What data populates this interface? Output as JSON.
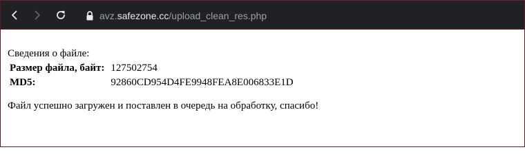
{
  "browser": {
    "url": {
      "prefix": "avz.",
      "domain": "safezone.cc",
      "path": "/upload_clean_res.php"
    },
    "colors": {
      "toolbar_bg": "#202124",
      "frame_accent": "#6b1f2c"
    },
    "icons": {
      "back": "back-arrow-icon",
      "forward": "forward-arrow-icon",
      "reload": "reload-icon",
      "secure": "lock-icon"
    }
  },
  "page": {
    "section_title": "Сведения о файле:",
    "file_info": [
      {
        "label": "Размер файла, байт:",
        "value": "127502754"
      },
      {
        "label": "MD5:",
        "value": "92860CD954D4FE9948FEA8E006833E1D"
      }
    ],
    "message": "Файл успешно загружен и поставлен в очередь на обработку, спасибо!"
  }
}
